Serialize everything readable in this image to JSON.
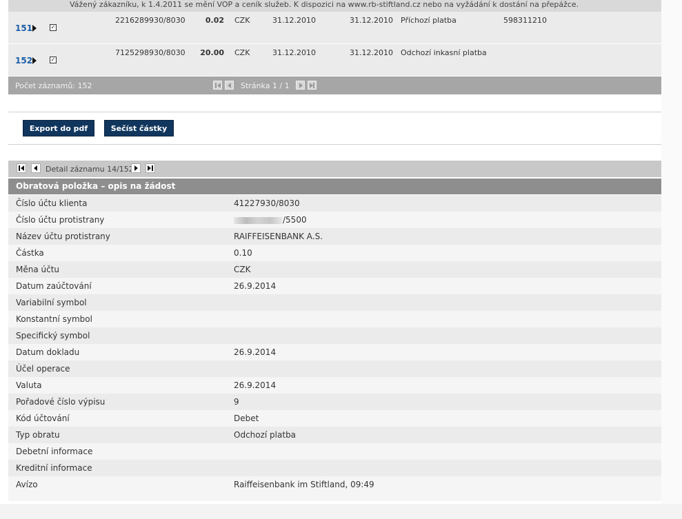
{
  "notice": "Vážený zákazníku, k 1.4.2011 se mění VOP a ceník služeb. K dispozici na www.rb-stiftland.cz nebo na vyžádání k dostání na přepážce.",
  "transactions": [
    {
      "num": "151",
      "account": "2216289930/8030",
      "amount": "0.02",
      "currency": "CZK",
      "date1": "31.12.2010",
      "date2": "31.12.2010",
      "type": "Příchozí platba",
      "vs": "598311210"
    },
    {
      "num": "152",
      "account": "7125298930/8030",
      "amount": "20.00",
      "currency": "CZK",
      "date1": "31.12.2010",
      "date2": "31.12.2010",
      "type": "Odchozí inkasní platba",
      "vs": ""
    }
  ],
  "pager": {
    "count_label": "Počet záznamů: 152",
    "page_label": "Stránka 1 / 1"
  },
  "buttons": {
    "export": "Export do pdf",
    "sum": "Sečíst částky"
  },
  "detail": {
    "nav_label": "Detail záznamu 14/152",
    "header": "Obratová položka – opis na žádost",
    "rows": [
      {
        "label": "Číslo účtu klienta",
        "value": "41227930/8030"
      },
      {
        "label": "Číslo účtu protistrany",
        "value": "/5500"
      },
      {
        "label": "Název účtu protistrany",
        "value": "RAIFFEISENBANK A.S."
      },
      {
        "label": "Částka",
        "value": "0.10"
      },
      {
        "label": "Měna účtu",
        "value": "CZK"
      },
      {
        "label": "Datum zaúčtování",
        "value": "26.9.2014"
      },
      {
        "label": "Variabilní symbol",
        "value": ""
      },
      {
        "label": "Konstantní symbol",
        "value": ""
      },
      {
        "label": "Specifický symbol",
        "value": ""
      },
      {
        "label": "Datum dokladu",
        "value": "26.9.2014"
      },
      {
        "label": "Účel operace",
        "value": ""
      },
      {
        "label": "Valuta",
        "value": "26.9.2014"
      },
      {
        "label": "Pořadové číslo výpisu",
        "value": "9"
      },
      {
        "label": "Kód účtování",
        "value": "Debet"
      },
      {
        "label": "Typ obratu",
        "value": "Odchozí platba"
      },
      {
        "label": "Debetní informace",
        "value": ""
      },
      {
        "label": "Kreditní informace",
        "value": ""
      },
      {
        "label": "Avízo",
        "value": "Raiffeisenbank im Stiftland, 09:49"
      }
    ]
  }
}
